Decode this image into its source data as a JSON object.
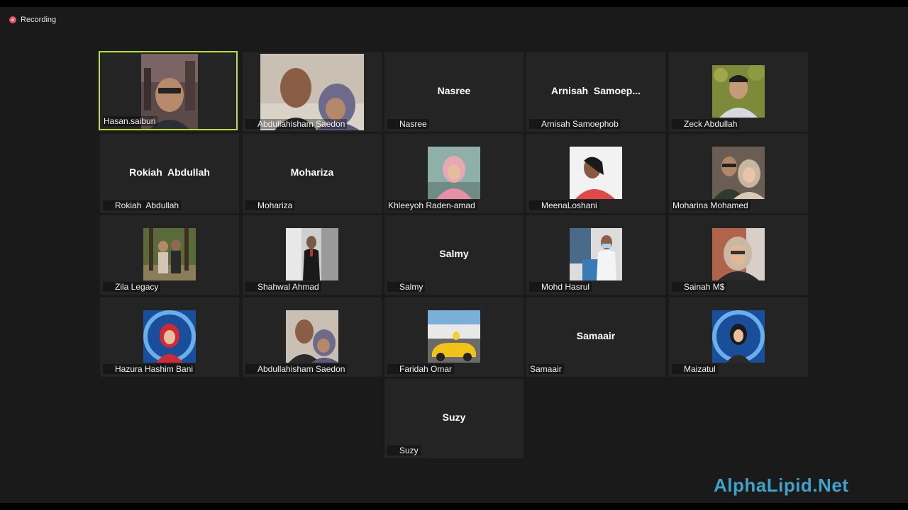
{
  "recording": {
    "label": "Recording"
  },
  "brand": {
    "text": "AlphaLipid.Net"
  },
  "colors": {
    "active_border": "#b9df3a",
    "muted_mic": "#e0545a",
    "brand": "#3ea2c9"
  },
  "tiles": [
    {
      "name": "Hasan.saiburi",
      "muted": false,
      "has_photo": true,
      "active": true
    },
    {
      "name": "Abdullahisham Saedon",
      "muted": true,
      "has_photo": true
    },
    {
      "name": "Nasree",
      "display_name": "Nasree",
      "muted": true,
      "has_photo": false
    },
    {
      "name": "Arnisah Samoephob",
      "display_name": "Arnisah  Samoep...",
      "muted": true,
      "has_photo": false
    },
    {
      "name": "Zeck Abdullah",
      "muted": true,
      "has_photo": true
    },
    {
      "name": "Rokiah  Abdullah",
      "display_name": "Rokiah  Abdullah",
      "muted": true,
      "has_photo": false
    },
    {
      "name": "Mohariza",
      "display_name": "Mohariza",
      "muted": true,
      "has_photo": false
    },
    {
      "name": "Khleeyoh Raden-amad",
      "muted": false,
      "has_photo": true
    },
    {
      "name": "MeenaLoshani",
      "muted": true,
      "has_photo": true
    },
    {
      "name": "Moharina Mohamed",
      "muted": false,
      "has_photo": true
    },
    {
      "name": "Zila Legacy",
      "muted": true,
      "has_photo": true
    },
    {
      "name": "Shahwal Ahmad",
      "muted": true,
      "has_photo": true
    },
    {
      "name": "Salmy",
      "display_name": "Salmy",
      "muted": true,
      "has_photo": false
    },
    {
      "name": "Mohd Hasrul",
      "muted": true,
      "has_photo": true
    },
    {
      "name": "Sainah M$",
      "muted": true,
      "has_photo": true
    },
    {
      "name": "Hazura Hashim Bani",
      "muted": true,
      "has_photo": true
    },
    {
      "name": "Abdullahisham Saedon",
      "muted": true,
      "has_photo": true
    },
    {
      "name": "Faridah Omar",
      "muted": true,
      "has_photo": true
    },
    {
      "name": "Samaair",
      "display_name": "Samaair",
      "muted": false,
      "has_photo": false
    },
    {
      "name": "Maizatul",
      "muted": true,
      "has_photo": true
    },
    {
      "name": "Suzy",
      "display_name": "Suzy",
      "muted": true,
      "has_photo": false
    }
  ]
}
